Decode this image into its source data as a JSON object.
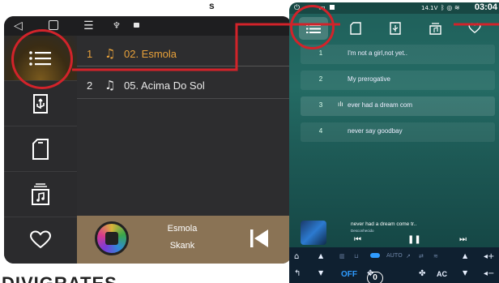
{
  "fragments": {
    "top": "s",
    "bottom": "DIVIGRATES"
  },
  "left_screen": {
    "status_icons": [
      "back-icon",
      "square-icon",
      "menu-icon",
      "usb-icon",
      "notification-icon"
    ],
    "sidebar": [
      {
        "name": "playlist",
        "icon": "list-icon",
        "active": true
      },
      {
        "name": "usb",
        "icon": "usb-drive-icon",
        "active": false
      },
      {
        "name": "sd",
        "icon": "sd-card-icon",
        "active": false
      },
      {
        "name": "folder",
        "icon": "music-folder-icon",
        "active": false
      },
      {
        "name": "favorites",
        "icon": "heart-icon",
        "active": false
      }
    ],
    "tracks": [
      {
        "num": "1",
        "title": "02. Esmola",
        "playing": true
      },
      {
        "num": "2",
        "title": "05. Acima Do Sol",
        "playing": false
      }
    ],
    "now_playing": {
      "song": "Esmola",
      "artist": "Skank"
    },
    "colors": {
      "accent": "#e8a13a",
      "annotation": "#d2232a",
      "player_bar": "#8a7355"
    }
  },
  "right_screen": {
    "status_time": "03:04",
    "status_voltage": "14.1V",
    "tracks": [
      {
        "num": "1",
        "title": "I'm not a girl,not yet.."
      },
      {
        "num": "2",
        "title": "My prerogative"
      },
      {
        "num": "3",
        "title": "ever had a dream com",
        "playing": true
      },
      {
        "num": "4",
        "title": "never say goodbay"
      }
    ],
    "now_playing": {
      "title": "never had a dream come tr..",
      "subtitle": "Desconhecido"
    },
    "climate": {
      "off": "OFF",
      "fan": "0",
      "ac": "AC",
      "auto": "AUTO"
    }
  }
}
